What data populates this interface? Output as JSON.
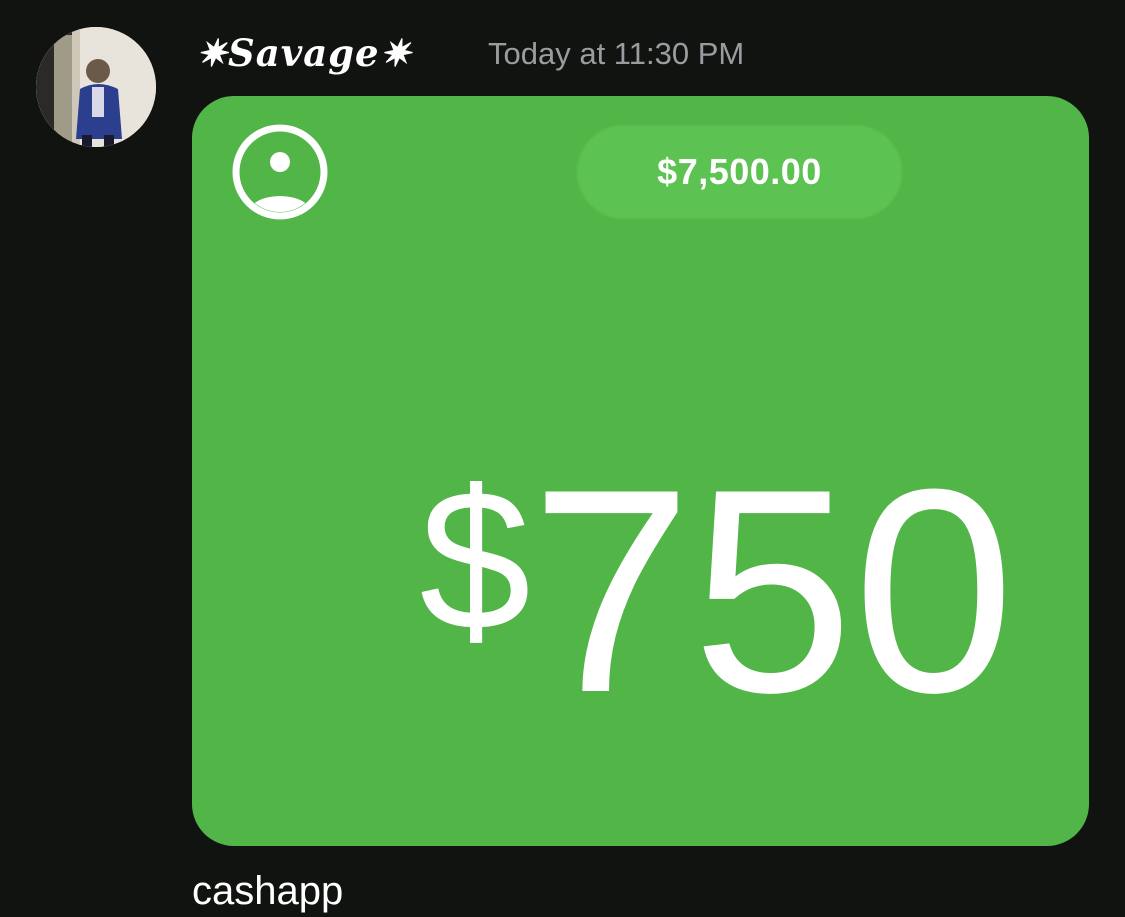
{
  "message": {
    "author": {
      "name": "✷Savage✷",
      "avatar_icon": "user-avatar"
    },
    "timestamp": "Today at 11:30 PM",
    "text": "cashapp",
    "attachment": {
      "type": "image",
      "profile_icon": "person-circle-icon",
      "balance": "$7,500.00",
      "amount_symbol": "$",
      "amount_value": "750",
      "colors": {
        "card_green": "#52b548",
        "pill_green": "#5cc251",
        "text": "#ffffff"
      }
    }
  },
  "theme": {
    "background": "#111311",
    "timestamp_color": "#9a9c9f"
  }
}
